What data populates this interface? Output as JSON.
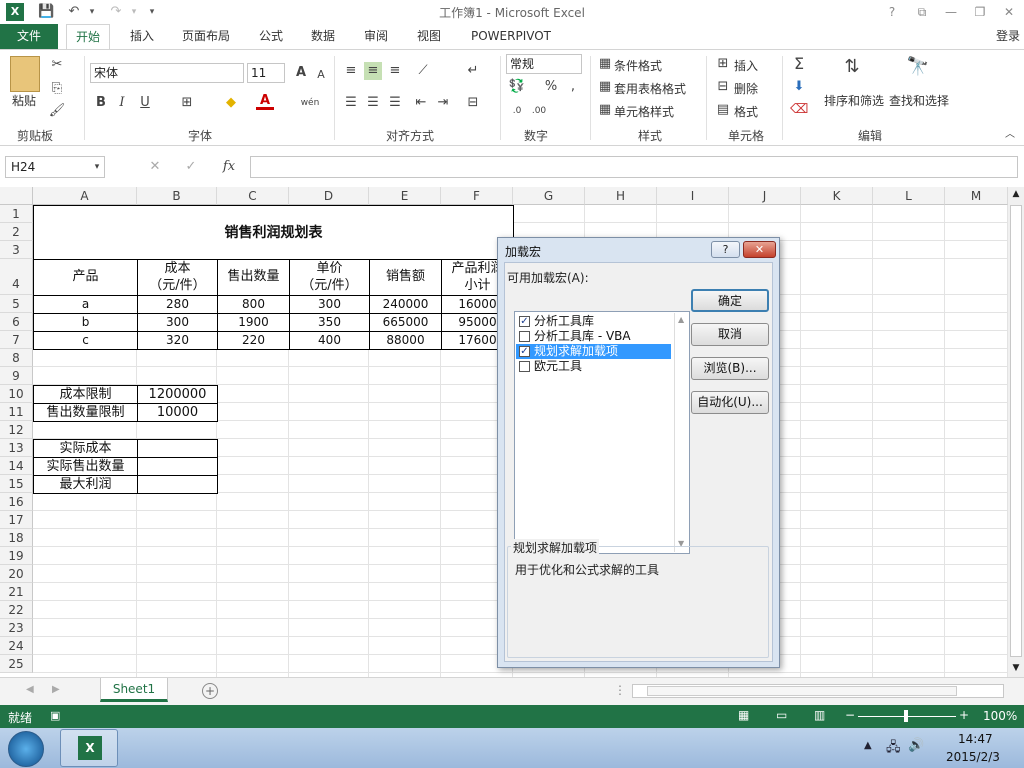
{
  "titlebar": {
    "title": "工作簿1 - Microsoft Excel",
    "help": "?",
    "min": "—",
    "restore": "❐",
    "close": "✕",
    "save_icon": "floppy-icon",
    "logo": "X"
  },
  "tabs": [
    "文件",
    "开始",
    "插入",
    "页面布局",
    "公式",
    "数据",
    "审阅",
    "视图",
    "POWERPIVOT"
  ],
  "login": "登录",
  "ribbon": {
    "clipboard": {
      "paste": "粘贴",
      "label": "剪贴板"
    },
    "font": {
      "name": "宋体",
      "size": "11",
      "label": "字体",
      "bold": "B",
      "italic": "I",
      "underline": "U",
      "grow": "A",
      "shrink": "A",
      "color_a": "A",
      "wen": "wén"
    },
    "align": {
      "label": "对齐方式"
    },
    "number": {
      "format": "常规",
      "percent": "%",
      "comma": ",",
      "label": "数字"
    },
    "styles": {
      "cond": "条件格式",
      "table": "套用表格格式",
      "cell": "单元格样式",
      "label": "样式"
    },
    "cells": {
      "insert": "插入",
      "delete": "删除",
      "format": "格式",
      "label": "单元格"
    },
    "editing": {
      "sigma": "Σ",
      "sort": "排序和筛选",
      "find": "查找和选择",
      "label": "编辑"
    }
  },
  "formula": {
    "cell_ref": "H24",
    "fx": "fx",
    "cancel": "✕",
    "enter": "✓",
    "value": ""
  },
  "columns": [
    "A",
    "B",
    "C",
    "D",
    "E",
    "F",
    "G",
    "H",
    "I",
    "J",
    "K",
    "L",
    "M"
  ],
  "rows": [
    "1",
    "2",
    "3",
    "4",
    "5",
    "6",
    "7",
    "8",
    "9",
    "10",
    "11",
    "12",
    "13",
    "14",
    "15",
    "16",
    "17",
    "18",
    "19",
    "20",
    "21",
    "22",
    "23",
    "24",
    "25"
  ],
  "sheet": {
    "title": "销售利润规划表",
    "headers": [
      "产品",
      "成本\n（元/件）",
      "售出数量",
      "单价\n（元/件）",
      "销售额",
      "产品利润\n小计"
    ],
    "data": [
      [
        "a",
        "280",
        "800",
        "300",
        "240000",
        "16000"
      ],
      [
        "b",
        "300",
        "1900",
        "350",
        "665000",
        "95000"
      ],
      [
        "c",
        "320",
        "220",
        "400",
        "88000",
        "17600"
      ]
    ],
    "limits": [
      [
        "成本限制",
        "1200000"
      ],
      [
        "售出数量限制",
        "10000"
      ]
    ],
    "results": [
      "实际成本",
      "实际售出数量",
      "最大利润"
    ]
  },
  "sheet_tab": "Sheet1",
  "status": {
    "ready": "就绪",
    "zoom": "100%",
    "minus": "−",
    "plus": "+"
  },
  "taskbar": {
    "time": "14:47",
    "date": "2015/2/3"
  },
  "dialog": {
    "title": "加载宏",
    "list_label": "可用加载宏(A):",
    "items": [
      {
        "label": "分析工具库",
        "checked": true
      },
      {
        "label": "分析工具库 - VBA",
        "checked": false
      },
      {
        "label": "规划求解加载项",
        "checked": true
      },
      {
        "label": "欧元工具",
        "checked": false
      }
    ],
    "ok": "确定",
    "cancel": "取消",
    "browse": "浏览(B)...",
    "automation": "自动化(U)...",
    "desc_title": "规划求解加载项",
    "desc_text": "用于优化和公式求解的工具",
    "help": "?",
    "close": "✕"
  },
  "colors": {
    "excel_green": "#217346",
    "selection": "#3399ff"
  }
}
